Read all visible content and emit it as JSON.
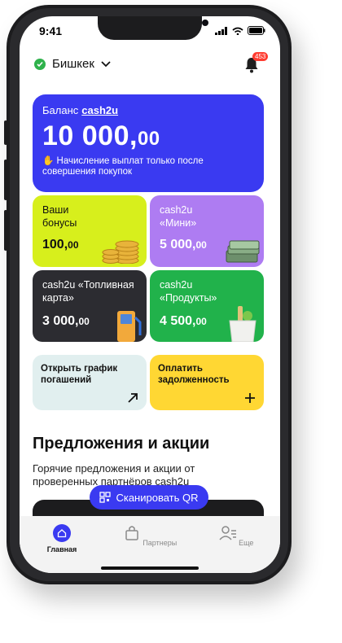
{
  "status": {
    "time": "9:41"
  },
  "header": {
    "city": "Бишкек",
    "notifications": "453"
  },
  "balance": {
    "label": "Баланс",
    "brand": "cash2u",
    "amount_main": "10 000,",
    "amount_cents": "00",
    "note": "Начисление выплат только после совершения покупок"
  },
  "tiles": {
    "bonus": {
      "title": "Ваши бонусы",
      "amount_main": "100,",
      "amount_cents": "00"
    },
    "mini": {
      "title": "cash2u «Мини»",
      "amount_main": "5 000,",
      "amount_cents": "00"
    },
    "fuel": {
      "title": "cash2u «Топливная карта»",
      "amount_main": "3 000,",
      "amount_cents": "00"
    },
    "products": {
      "title": "cash2u «Продукты»",
      "amount_main": "4 500,",
      "amount_cents": "00"
    }
  },
  "actions": {
    "schedule": "Открыть график погашений",
    "pay": "Оплатить задолженность"
  },
  "offers": {
    "title": "Предложения и акции",
    "subtitle": "Горячие предложения и акции от проверенных партнёров cash2u"
  },
  "scan": {
    "label": "Сканировать QR"
  },
  "tabs": {
    "home": "Главная",
    "partners": "Партнеры",
    "more": "Еще"
  },
  "colors": {
    "primary": "#3a3af1",
    "lime": "#d7ef1c",
    "violet": "#ae7cf2",
    "dark": "#2c2c31",
    "green": "#21b24b",
    "yellow": "#ffd733",
    "mint": "#e1efef",
    "alert": "#ff3b30"
  }
}
